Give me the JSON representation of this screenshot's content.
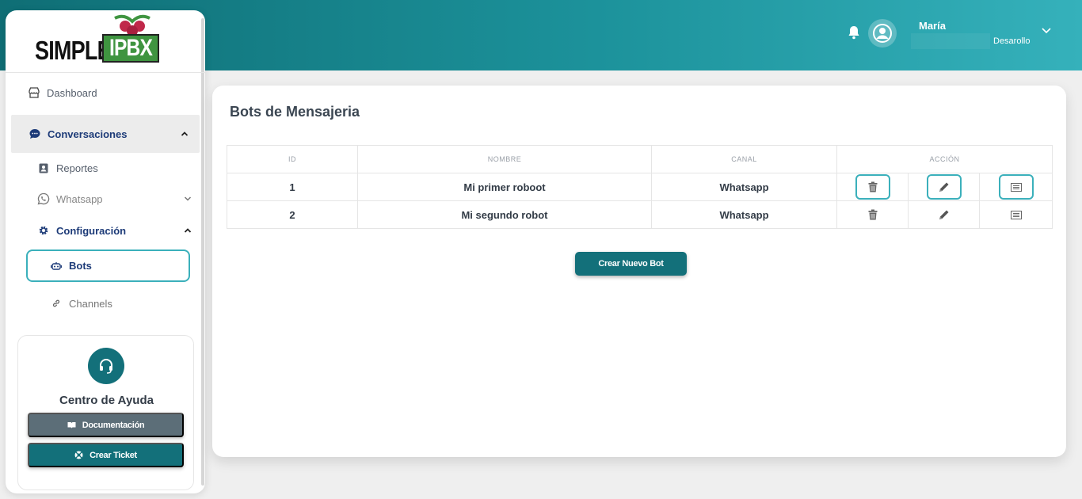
{
  "header": {
    "user_name": "María",
    "user_role": "Desarollo"
  },
  "logo": {
    "text_left": "SIMPLE",
    "text_right": "IPBX"
  },
  "sidebar": {
    "dashboard": "Dashboard",
    "conversaciones": "Conversaciones",
    "reportes": "Reportes",
    "whatsapp": "Whatsapp",
    "configuracion": "Configuración",
    "bots": "Bots",
    "channels": "Channels"
  },
  "help": {
    "title": "Centro de Ayuda",
    "doc_label": "Documentación",
    "ticket_label": "Crear Ticket"
  },
  "main": {
    "title": "Bots de Mensajeria",
    "columns": [
      "ID",
      "NOMBRE",
      "CANAL",
      "ACCIÓN"
    ],
    "rows": [
      {
        "id": "1",
        "nombre": "Mi primer roboot",
        "canal": "Whatsapp"
      },
      {
        "id": "2",
        "nombre": "Mi segundo robot",
        "canal": "Whatsapp"
      }
    ],
    "create_label": "Crear Nuevo Bot"
  },
  "colors": {
    "accent": "#13707a",
    "highlight": "#3bb0bb",
    "nav_active": "#1d3b78"
  }
}
